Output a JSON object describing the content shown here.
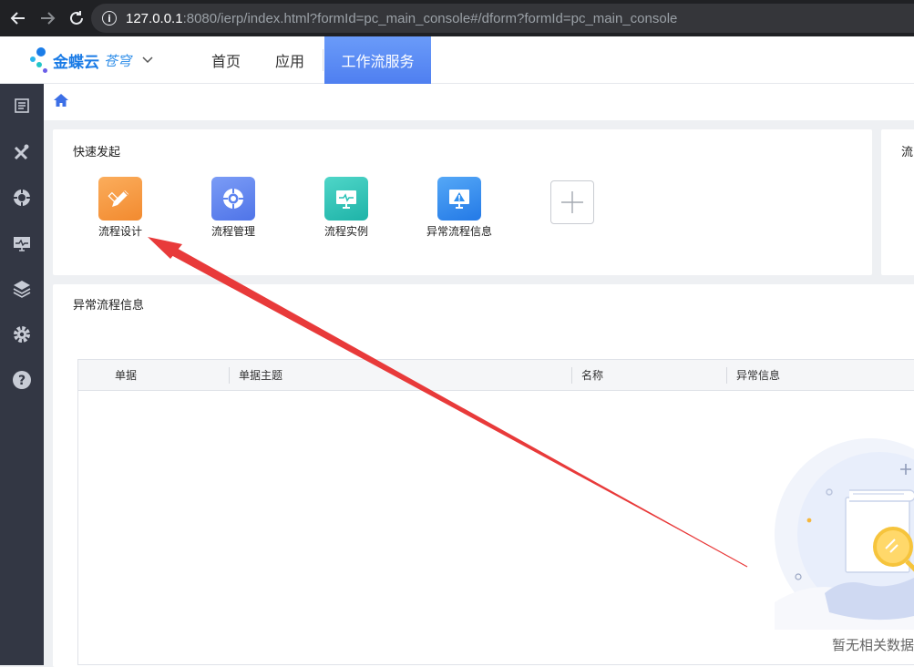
{
  "browser": {
    "url_host": "127.0.0.1",
    "url_rest": ":8080/ierp/index.html?formId=pc_main_console#/dform?formId=pc_main_console",
    "back_icon": "arrow-left-icon",
    "forward_icon": "arrow-right-icon",
    "reload_icon": "reload-icon",
    "info_icon": "info-icon"
  },
  "header": {
    "logo_text": "金蝶云",
    "logo_sub": "苍穹",
    "tabs": [
      {
        "label": "首页"
      },
      {
        "label": "应用"
      },
      {
        "label": "工作流服务"
      }
    ],
    "active_tab": 2,
    "accent_color": "#5b8ff9"
  },
  "sidebar": {
    "icons": [
      "document-icon",
      "tools-icon",
      "target-icon",
      "monitor-icon",
      "layers-icon",
      "gear-icon",
      "help-icon"
    ]
  },
  "breadcrumb": {
    "icon": "home-icon"
  },
  "quick_start": {
    "title": "快速发起",
    "items": [
      {
        "label": "流程设计",
        "icon": "pencil-ruler-icon",
        "color": "#f7923b"
      },
      {
        "label": "流程管理",
        "icon": "target-icon",
        "color": "#5b83f0"
      },
      {
        "label": "流程实例",
        "icon": "monitor-icon",
        "color": "#28c2b6"
      },
      {
        "label": "异常流程信息",
        "icon": "warning-monitor-icon",
        "color": "#2f8ff0"
      }
    ],
    "add_icon": "plus-icon"
  },
  "right_card": {
    "title": "流"
  },
  "exceptions": {
    "title": "异常流程信息",
    "columns": [
      "单据",
      "单据主题",
      "名称",
      "异常信息"
    ],
    "rows": [],
    "empty_text": "暂无相关数据"
  },
  "annotation": {
    "color": "#e83a3a"
  }
}
